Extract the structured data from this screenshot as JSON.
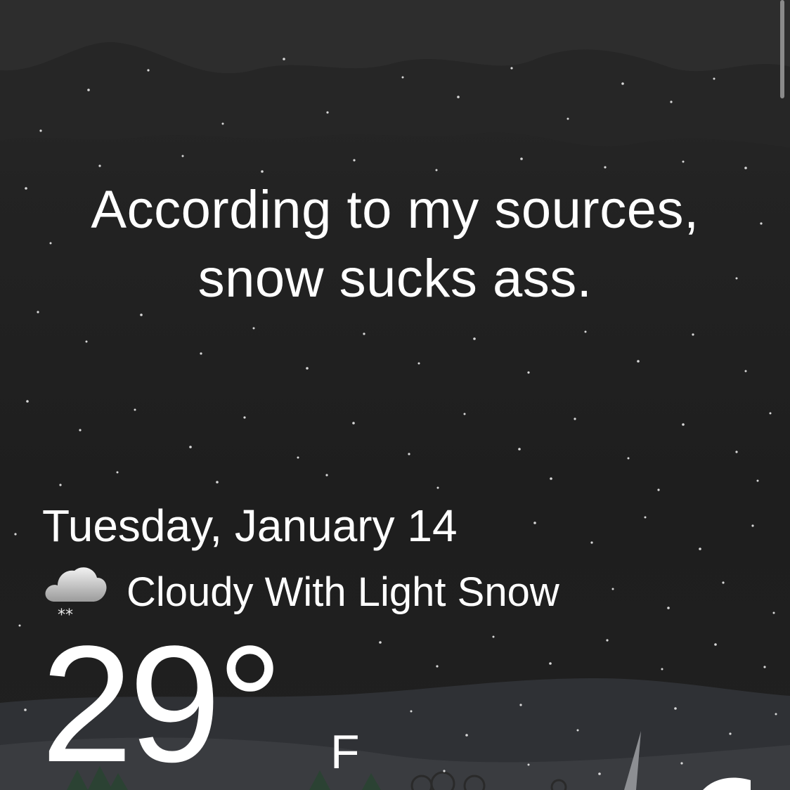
{
  "quip": {
    "line1": "According to my sources,",
    "line2": "snow sucks ass."
  },
  "weather": {
    "date": "Tuesday, January 14",
    "condition": "Cloudy With Light Snow",
    "condition_icon": "cloud-snow-icon",
    "temperature": "29°",
    "unit": "F"
  },
  "colors": {
    "background": "#1e1e1e",
    "text": "#ffffff",
    "hills": "#34363a"
  }
}
